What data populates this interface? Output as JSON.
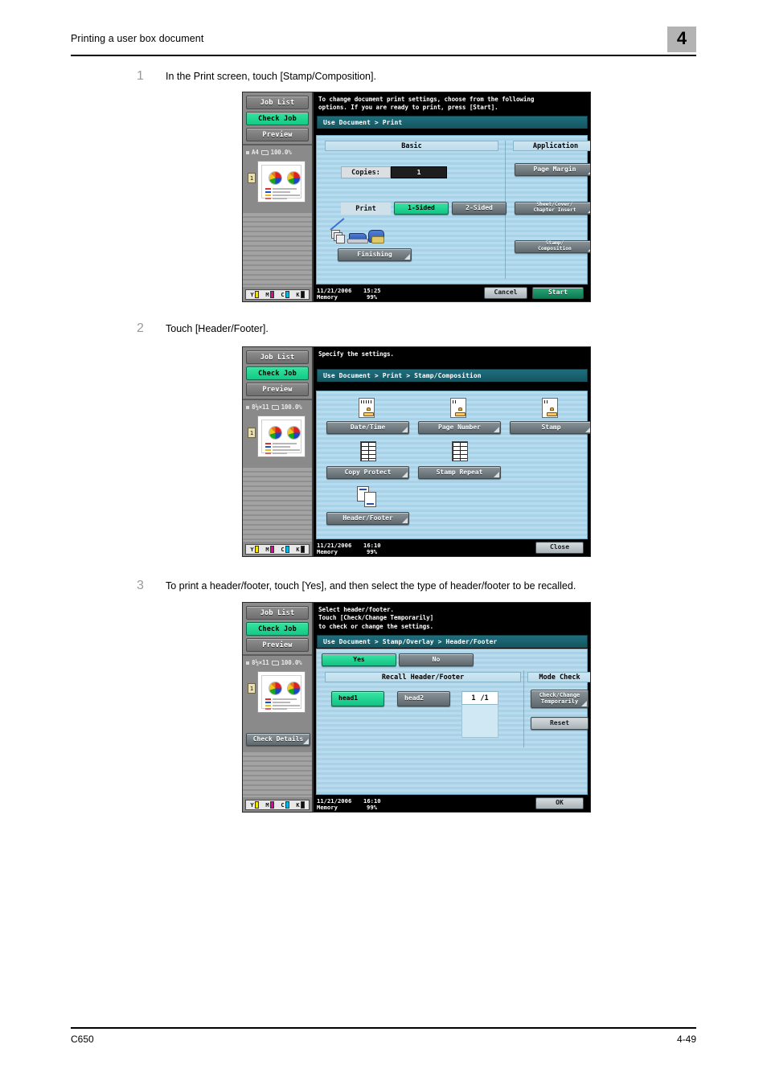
{
  "document": {
    "header_title": "Printing a user box document",
    "chapter_number": "4",
    "footer_left": "C650",
    "footer_right": "4-49"
  },
  "steps": [
    {
      "number": "1",
      "text": "In the Print screen, touch [Stamp/Composition]."
    },
    {
      "number": "2",
      "text": "Touch [Header/Footer]."
    },
    {
      "number": "3",
      "text": "To print a header/footer, touch [Yes], and then select the type of header/footer to be recalled."
    }
  ],
  "panel1": {
    "rail": {
      "job_list": "Job List",
      "check_job": "Check Job",
      "preview": "Preview",
      "paper_size": "A4",
      "zoom": "100.0%",
      "page_badge": "1",
      "toner": [
        {
          "label": "Y",
          "color": "#f5e000"
        },
        {
          "label": "M",
          "color": "#e5009e"
        },
        {
          "label": "C",
          "color": "#00b9e4"
        },
        {
          "label": "K",
          "color": "#101010"
        }
      ]
    },
    "message": "To change document print settings, choose from the following\noptions. If you are ready to print, press [Start].",
    "breadcrumb": "Use Document > Print",
    "tab_basic": "Basic",
    "tab_application": "Application",
    "copies_label": "Copies:",
    "copies_value": "1",
    "print_label": "Print",
    "sided_1": "1-Sided",
    "sided_2": "2-Sided",
    "finishing": "Finishing",
    "app_buttons": [
      "Page Margin",
      "Sheet/Cover/\nChapter Insert",
      "Stamp/\nComposition"
    ],
    "status": {
      "date": "11/21/2006",
      "time": "15:25",
      "memory_label": "Memory",
      "memory_value": "99%"
    },
    "cancel": "Cancel",
    "start": "Start"
  },
  "panel2": {
    "rail": {
      "job_list": "Job List",
      "check_job": "Check Job",
      "preview": "Preview",
      "paper_size": "8½×11",
      "zoom": "100.0%",
      "page_badge": "1",
      "toner": [
        {
          "label": "Y",
          "color": "#f5e000"
        },
        {
          "label": "M",
          "color": "#e5009e"
        },
        {
          "label": "C",
          "color": "#00b9e4"
        },
        {
          "label": "K",
          "color": "#101010"
        }
      ]
    },
    "message": "Specify the settings.",
    "breadcrumb": "Use Document > Print > Stamp/Composition",
    "tiles": [
      {
        "label": "Date/Time",
        "icon": "stamp-doc-icon"
      },
      {
        "label": "Page Number",
        "icon": "stamp-doc-icon"
      },
      {
        "label": "Stamp",
        "icon": "stamp-doc-icon"
      },
      {
        "label": "Copy Protect",
        "icon": "grid-doc-icon"
      },
      {
        "label": "Stamp Repeat",
        "icon": "grid-doc-icon"
      },
      {
        "label": "Header/Footer",
        "icon": "header-footer-icon"
      }
    ],
    "status": {
      "date": "11/21/2006",
      "time": "16:10",
      "memory_label": "Memory",
      "memory_value": "99%"
    },
    "close": "Close"
  },
  "panel3": {
    "rail": {
      "job_list": "Job List",
      "check_job": "Check Job",
      "preview": "Preview",
      "paper_size": "8½×11",
      "zoom": "100.0%",
      "page_badge": "1",
      "check_details": "Check Details",
      "toner": [
        {
          "label": "Y",
          "color": "#f5e000"
        },
        {
          "label": "M",
          "color": "#e5009e"
        },
        {
          "label": "C",
          "color": "#00b9e4"
        },
        {
          "label": "K",
          "color": "#101010"
        }
      ]
    },
    "message": "Select header/footer.\nTouch [Check/Change Temporarily]\nto check or change the settings.",
    "breadcrumb": "Use Document > Stamp/Overlay > Header/Footer",
    "yes": "Yes",
    "no": "No",
    "recall_header": "Recall Header/Footer",
    "mode_check_header": "Mode Check",
    "recall_items": [
      {
        "label": "head1",
        "selected": true
      },
      {
        "label": "head2",
        "selected": false
      }
    ],
    "page_current": "1",
    "page_total": "/1",
    "check_change": "Check/Change\nTemporarily",
    "reset": "Reset",
    "status": {
      "date": "11/21/2006",
      "time": "16:10",
      "memory_label": "Memory",
      "memory_value": "99%"
    },
    "ok": "OK"
  },
  "colors": {
    "accent_green": "#19cf8b",
    "breadcrumb_teal": "#1d6f7e",
    "panel_blue": "#b0d6e9",
    "chapter_tab_gray": "#b3b3b3"
  }
}
